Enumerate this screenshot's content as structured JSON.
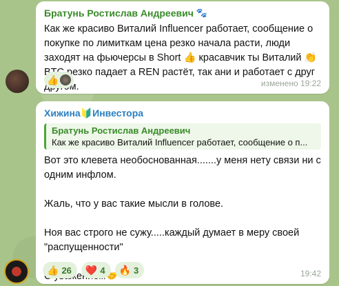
{
  "message1": {
    "sender": "Братунь Ростислав Андреевич",
    "sender_badge_icon": "paw-icon",
    "text": "Как же красиво Виталий Influencer работает, сообщение о покупке по лимиткам цена резко начала расти, люди заходят на фьючерсы в Short 👍 красавчик ты Виталий 👏 BTC резко падает а REN растёт, так ани и работает с друг другом.",
    "reaction_emoji": "👍",
    "timestamp": "изменено 19:22"
  },
  "message2": {
    "sender": "Хижина🔰Инвестора",
    "reply": {
      "name": "Братунь Ростислав Андреевич",
      "text": "Как же красиво Виталий Influencer работает, сообщение о п..."
    },
    "text": "Вот это клевета необоснованная.......у меня нету связи ни с одним инфлом.\n\nЖаль, что у вас такие мысли в голове.\n\nНоя вас строго не сужу.....каждый думает в меру своей \"распущенности\"\n\nС уважением🤝",
    "reactions": [
      {
        "emoji": "👍",
        "count": "26"
      },
      {
        "emoji": "❤️",
        "count": "4"
      },
      {
        "emoji": "🔥",
        "count": "3"
      }
    ],
    "timestamp": "19:42"
  },
  "colors": {
    "background": "#a9c48a",
    "bubble": "#ffffff",
    "sender1": "#3a8a2a",
    "sender2": "#2b7fc1",
    "reaction_bg": "#e4f1dd"
  }
}
